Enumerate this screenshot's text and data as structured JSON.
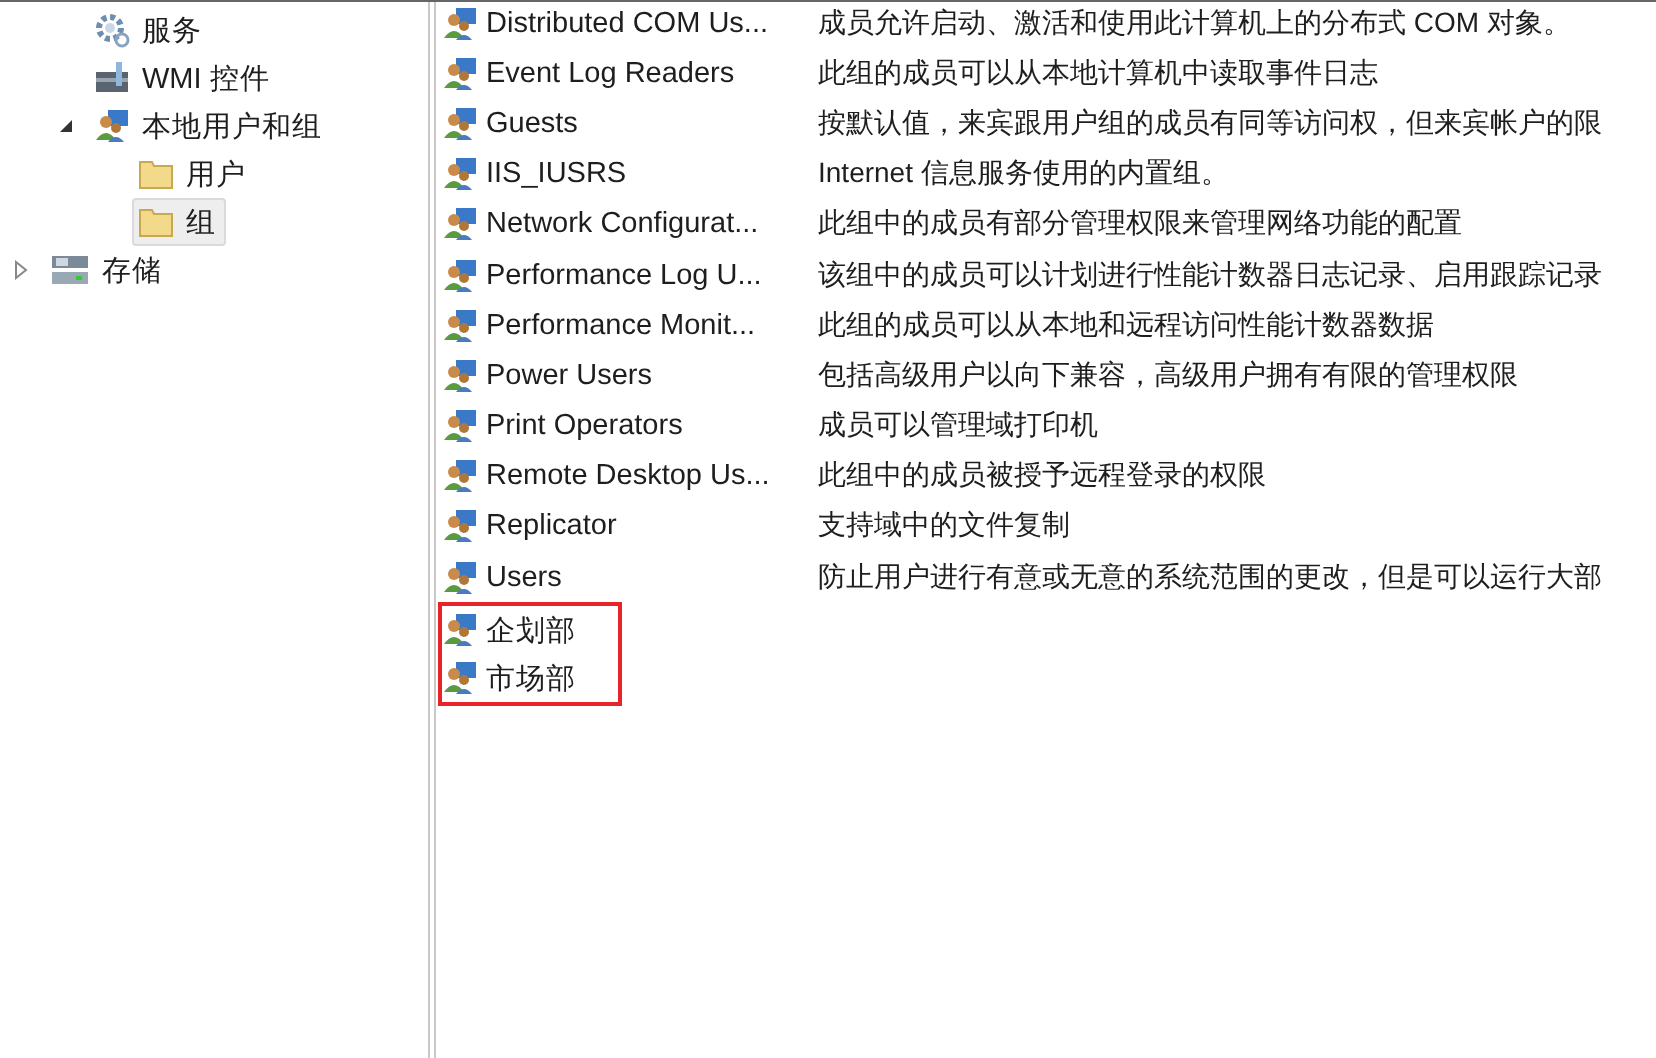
{
  "sidebar": {
    "items": [
      {
        "children": [
          {
            "label": "服务",
            "kind": "gear",
            "selected": false
          },
          {
            "label": "WMI 控件",
            "kind": "wmi",
            "selected": false
          },
          {
            "label": "本地用户和组",
            "kind": "users",
            "expanded": true,
            "selected": false,
            "children": [
              {
                "label": "用户",
                "kind": "folder",
                "selected": false
              },
              {
                "label": "组",
                "kind": "folder",
                "selected": true
              }
            ]
          }
        ]
      },
      {
        "label": "存储",
        "kind": "storage",
        "expanded": false,
        "selected": false
      }
    ]
  },
  "groups": [
    {
      "name": "Distributed COM Us...",
      "description": "成员允许启动、激活和使用此计算机上的分布式 COM 对象。",
      "highlighted": false
    },
    {
      "name": "Event Log Readers",
      "description": "此组的成员可以从本地计算机中读取事件日志",
      "highlighted": false
    },
    {
      "name": "Guests",
      "description": "按默认值，来宾跟用户组的成员有同等访问权，但来宾帐户的限",
      "highlighted": false
    },
    {
      "name": "IIS_IUSRS",
      "description": "Internet 信息服务使用的内置组。",
      "highlighted": false
    },
    {
      "name": "Network Configurat...",
      "description": "此组中的成员有部分管理权限来管理网络功能的配置",
      "highlighted": false
    },
    {
      "name": "Performance Log U...",
      "description": "该组中的成员可以计划进行性能计数器日志记录、启用跟踪记录",
      "highlighted": false
    },
    {
      "name": "Performance Monit...",
      "description": "此组的成员可以从本地和远程访问性能计数器数据",
      "highlighted": false
    },
    {
      "name": "Power Users",
      "description": "包括高级用户以向下兼容，高级用户拥有有限的管理权限",
      "highlighted": false
    },
    {
      "name": "Print Operators",
      "description": "成员可以管理域打印机",
      "highlighted": false
    },
    {
      "name": "Remote Desktop Us...",
      "description": "此组中的成员被授予远程登录的权限",
      "highlighted": false
    },
    {
      "name": "Replicator",
      "description": "支持域中的文件复制",
      "highlighted": false
    },
    {
      "name": "Users",
      "description": "防止用户进行有意或无意的系统范围的更改，但是可以运行大部",
      "highlighted": false
    },
    {
      "name": "企划部",
      "highlighted": true
    },
    {
      "name": "市场部",
      "highlighted": true
    }
  ]
}
